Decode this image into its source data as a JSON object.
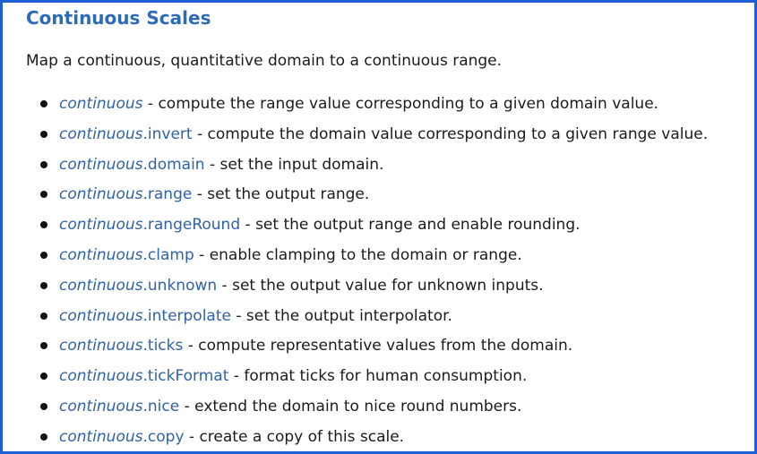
{
  "title": "Continuous Scales",
  "intro": "Map a continuous, quantitative domain to a continuous range.",
  "colors": {
    "border": "#1f5fd6",
    "title": "#2b6bb8",
    "link": "#2f62a8",
    "text": "#1b1b1b"
  },
  "items": [
    {
      "prefix": "continuous",
      "method": "",
      "description": " - compute the range value corresponding to a given domain value."
    },
    {
      "prefix": "continuous",
      "method": ".invert",
      "description": " - compute the domain value corresponding to a given range value."
    },
    {
      "prefix": "continuous",
      "method": ".domain",
      "description": " - set the input domain."
    },
    {
      "prefix": "continuous",
      "method": ".range",
      "description": " - set the output range."
    },
    {
      "prefix": "continuous",
      "method": ".rangeRound",
      "description": " - set the output range and enable rounding."
    },
    {
      "prefix": "continuous",
      "method": ".clamp",
      "description": " - enable clamping to the domain or range."
    },
    {
      "prefix": "continuous",
      "method": ".unknown",
      "description": " - set the output value for unknown inputs."
    },
    {
      "prefix": "continuous",
      "method": ".interpolate",
      "description": " - set the output interpolator."
    },
    {
      "prefix": "continuous",
      "method": ".ticks",
      "description": " - compute representative values from the domain."
    },
    {
      "prefix": "continuous",
      "method": ".tickFormat",
      "description": " - format ticks for human consumption."
    },
    {
      "prefix": "continuous",
      "method": ".nice",
      "description": " - extend the domain to nice round numbers."
    },
    {
      "prefix": "continuous",
      "method": ".copy",
      "description": " - create a copy of this scale."
    }
  ]
}
